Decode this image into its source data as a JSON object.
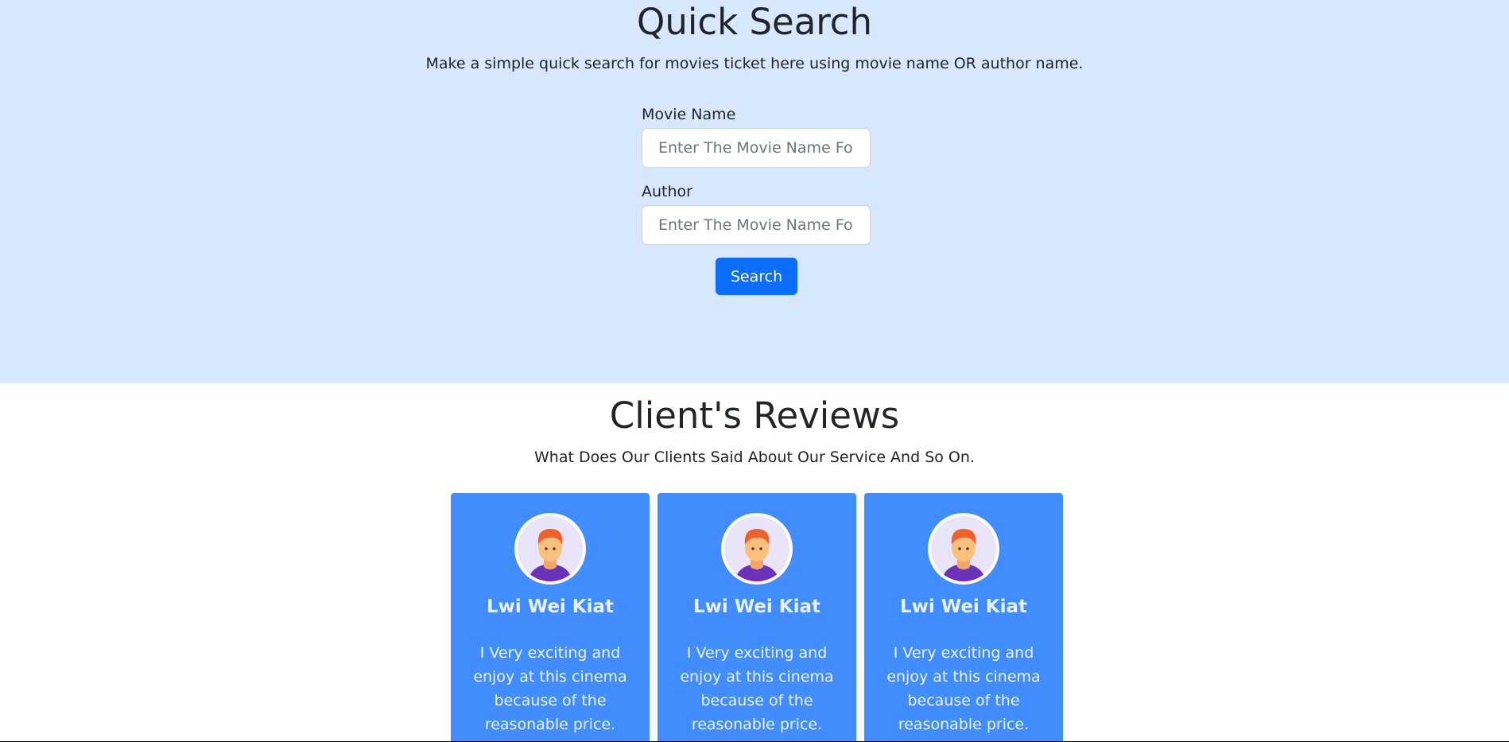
{
  "quick_search": {
    "title": "Quick Search",
    "subtitle": "Make a simple quick search for movies ticket here using movie name OR author name.",
    "movie_field": {
      "label": "Movie Name",
      "value": "",
      "placeholder": "Enter The Movie Name Fo"
    },
    "author_field": {
      "label": "Author",
      "value": "",
      "placeholder": "Enter The Movie Name Fo"
    },
    "search_label": "Search"
  },
  "reviews": {
    "title": "Client's Reviews",
    "subtitle": "What Does Our Clients Said About Our Service And So On.",
    "cards": [
      {
        "name": "Lwi Wei Kiat",
        "text": "I Very exciting and enjoy at this cinema because of the reasonable price.",
        "avatar_icon": "user-avatar-icon"
      },
      {
        "name": "Lwi Wei Kiat",
        "text": "I Very exciting and enjoy at this cinema because of the reasonable price.",
        "avatar_icon": "user-avatar-icon"
      },
      {
        "name": "Lwi Wei Kiat",
        "text": "I Very exciting and enjoy at this cinema because of the reasonable price.",
        "avatar_icon": "user-avatar-icon"
      }
    ]
  },
  "colors": {
    "search_bg": "#d7e7fd",
    "primary_button": "#0d6efd",
    "card_bg": "#428dfd"
  }
}
